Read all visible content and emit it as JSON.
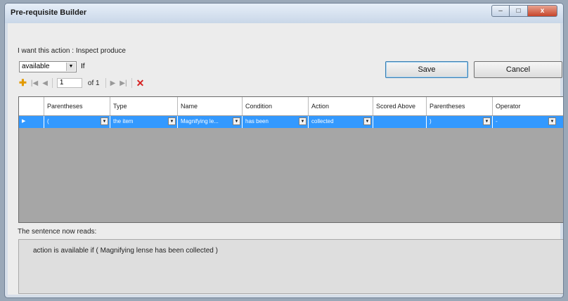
{
  "window": {
    "title": "Pre-requisite Builder",
    "controls": [
      "‒",
      "□",
      "x"
    ]
  },
  "header": {
    "want_text": "I want this  action : Inspect produce"
  },
  "availability": {
    "selected": "available",
    "if_label": "If"
  },
  "buttons": {
    "save": "Save",
    "cancel": "Cancel"
  },
  "navigator": {
    "position": "1",
    "of": "of 1"
  },
  "grid": {
    "columns": [
      "Parentheses",
      "Type",
      "Name",
      "Condition",
      "Action",
      "Scored Above",
      "Parentheses",
      "Operator"
    ],
    "rows": [
      {
        "cells": [
          "(",
          "the item",
          "Magnifying le...",
          "has been",
          "collected",
          "",
          ")",
          "-"
        ]
      }
    ]
  },
  "sentence": {
    "label": "The sentence now reads:",
    "text": "action is available if  ( Magnifying lense has been collected  )"
  },
  "colors": {
    "selection": "#3399ff",
    "grid_background": "#a6a6a6",
    "delete": "#d62020",
    "add": "#e29a00"
  }
}
